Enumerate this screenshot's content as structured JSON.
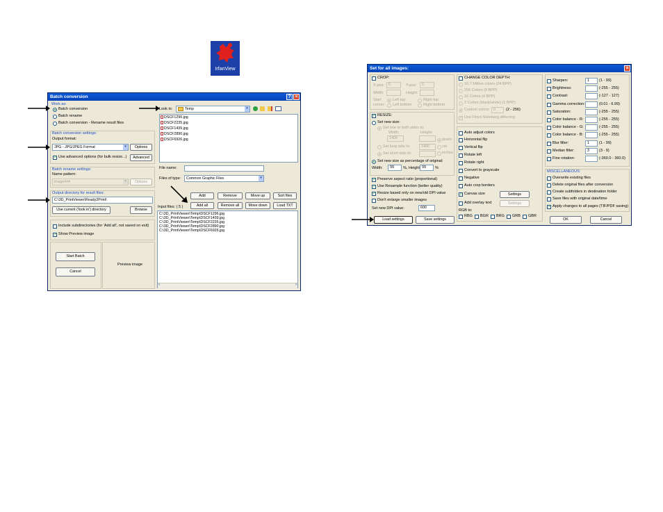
{
  "irfanview_icon": {
    "label": "IrfanView",
    "bg": "#1c3fa8"
  },
  "batch": {
    "title": "Batch conversion",
    "work_as": {
      "label": "Work as:",
      "options": [
        "Batch conversion",
        "Batch rename",
        "Batch conversion - Rename result files"
      ]
    },
    "conversion_settings": {
      "label": "Batch conversion settings:",
      "output_format_label": "Output format:",
      "format_value": "JPG - JPG/JPEG Format",
      "options_button": "Options",
      "advanced_checkbox": "Use advanced options (for bulk resize...)",
      "advanced_button": "Advanced"
    },
    "rename_settings": {
      "label": "Batch rename settings:",
      "name_pattern_label": "Name pattern:",
      "name_pattern_value": "image###",
      "options_button": "Options"
    },
    "output_dir": {
      "label": "Output directory for result files:",
      "value": "C:\\3D_PrintViewer\\Ready2Print\\",
      "use_current_button": "Use current ('look in') directory",
      "browse_button": "Browse"
    },
    "include_subdirs": "Include subdirectories (for 'Add all', not saved on exit)",
    "show_preview": "Show Preview image",
    "start_button": "Start Batch",
    "cancel_button": "Cancel",
    "preview_label": "Preview image",
    "look_in_label": "Look in:",
    "look_in_value": "Temp",
    "files": [
      "DSCF1296.jpg",
      "DSCF2235.jpg",
      "DSCF1439.jpg",
      "DSCF2890.jpg",
      "DSCF6926.jpg"
    ],
    "file_name_label": "File name:",
    "files_of_type_label": "Files of type:",
    "files_of_type_value": "Common Graphic Files",
    "buttons_row1": [
      "Add",
      "Remove",
      "Move up",
      "Sort files"
    ],
    "buttons_row2": [
      "Add all",
      "Remove all",
      "Move down",
      "Load TXT"
    ],
    "input_files_label": "Input files: ( 5 )",
    "input_files": [
      "C:\\3D_PrintViewer\\Temp\\DSCF1296.jpg",
      "C:\\3D_PrintViewer\\Temp\\DSCF1439.jpg",
      "C:\\3D_PrintViewer\\Temp\\DSCF2235.jpg",
      "C:\\3D_PrintViewer\\Temp\\DSCF2890.jpg",
      "C:\\3D_PrintViewer\\Temp\\DSCF6926.jpg"
    ]
  },
  "setall": {
    "title": "Set for all images:",
    "crop": {
      "label": "CROP:",
      "xpos_label": "X-pos:",
      "xpos_value": "0",
      "ypos_label": "Y-pos:",
      "ypos_value": "0",
      "width_label": "Width:",
      "height_label": "Height:",
      "start_label": "Start",
      "corner_label": "corner:",
      "corners": [
        "Left top",
        "Right top",
        "Left bottom",
        "Right bottom"
      ]
    },
    "resize": {
      "label": "RESIZE:",
      "set_new_size": "Set new size:",
      "set_one_both": "Set one or both sides to:",
      "width_label": "Width:",
      "height_label": "Height:",
      "width_value": "1400",
      "long_side": "Set long side to:",
      "long_value": "1400",
      "short_side": "Set short side to:",
      "units": [
        "pixels",
        "cm",
        "inches"
      ],
      "percentage": "Set new size as percentage of original:",
      "pct_width_label": "Width:",
      "pct_width_value": "99",
      "pct_height_label": "%, Height:",
      "pct_height_value": "99",
      "pct_unit": "%",
      "preserve": "Preserve aspect ratio (proportional)",
      "resample": "Use Resample function (better quality)",
      "dpi_based": "Resize based only on new/old DPI value",
      "dont_enlarge": "Don't enlarge smaller images",
      "dpi_label": "Set new DPI value:",
      "dpi_value": "600"
    },
    "color_depth": {
      "label": "CHANGE COLOR DEPTH:",
      "options": [
        "16,7 Million colors (24 BPP)",
        "256 Colors (8 BPP)",
        "16 Colors (4 BPP)",
        "2 Colors (black/white) (1 BPP)"
      ],
      "custom_label": "Custom colors:",
      "custom_value": "0",
      "custom_range": "(2 - 256)",
      "floyd": "Use Floyd-Steinberg dithering"
    },
    "misc_checks": [
      "Auto adjust colors",
      "Horizontal flip",
      "Vertical flip",
      "Rotate left",
      "Rotate right",
      "Convert to grayscale",
      "Negative",
      "Auto crop borders"
    ],
    "canvas_size": "Canvas size",
    "overlay_text": "Add overlay text",
    "settings_button": "Settings",
    "rgb_label": "RGB to:",
    "rgb_options": [
      "RBG",
      "BGR",
      "BRG",
      "GRB",
      "GBR"
    ],
    "adjust": [
      {
        "label": "Sharpen:",
        "value": "1",
        "range": "(1 - 99)"
      },
      {
        "label": "Brightness:",
        "value": "",
        "range": "(-255 - 255)"
      },
      {
        "label": "Contrast:",
        "value": "",
        "range": "(-127 - 127)"
      },
      {
        "label": "Gamma correction:",
        "value": "",
        "range": "(0.01 - 6.99)"
      },
      {
        "label": "Saturation:",
        "value": "",
        "range": "(-255 - 255)"
      },
      {
        "label": "Color balance - R:",
        "value": "",
        "range": "(-255 - 255)"
      },
      {
        "label": "Color balance - G:",
        "value": "",
        "range": "(-255 - 255)"
      },
      {
        "label": "Color balance - B:",
        "value": "",
        "range": "(-255 - 255)"
      },
      {
        "label": "Blur filter:",
        "value": "1",
        "range": "(1 - 99)"
      },
      {
        "label": "Median filter:",
        "value": "3",
        "range": "(3 - 9)"
      },
      {
        "label": "Fine rotation:",
        "value": "",
        "range": "(-360.0 - 360.0)"
      }
    ],
    "misc": {
      "label": "MISCELLANEOUS:",
      "options": [
        "Overwrite existing files",
        "Delete original files after conversion",
        "Create subfolders in destination folder",
        "Save files with original date/time",
        "Apply changes to all pages (TIF/PDF saving)"
      ]
    },
    "load_button": "Load settings",
    "save_button": "Save settings",
    "ok_button": "OK",
    "cancel_button": "Cancel"
  }
}
